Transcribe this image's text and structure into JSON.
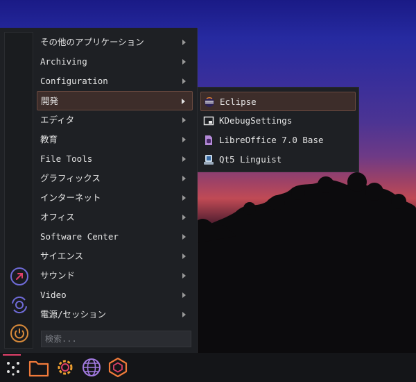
{
  "menu": {
    "items": [
      {
        "label": "その他のアプリケーション"
      },
      {
        "label": "Archiving"
      },
      {
        "label": "Configuration"
      },
      {
        "label": "開発"
      },
      {
        "label": "エディタ"
      },
      {
        "label": "教育"
      },
      {
        "label": "File Tools"
      },
      {
        "label": "グラフィックス"
      },
      {
        "label": "インターネット"
      },
      {
        "label": "オフィス"
      },
      {
        "label": "Software Center"
      },
      {
        "label": "サイエンス"
      },
      {
        "label": "サウンド"
      },
      {
        "label": "Video"
      },
      {
        "label": "電源/セッション"
      }
    ],
    "active_index": 3,
    "search_placeholder": "検索..."
  },
  "submenu": {
    "items": [
      {
        "label": "Eclipse",
        "icon": "eclipse-icon"
      },
      {
        "label": "KDebugSettings",
        "icon": "kdebugsettings-icon"
      },
      {
        "label": "LibreOffice 7.0 Base",
        "icon": "libreoffice-base-icon"
      },
      {
        "label": "Qt5 Linguist",
        "icon": "qt-linguist-icon"
      }
    ],
    "active_index": 0
  },
  "sidebar": {
    "buttons": [
      "logout-icon",
      "restart-icon",
      "power-icon"
    ]
  },
  "taskbar": {
    "icons": [
      "app-launcher-icon",
      "file-manager-icon",
      "settings-icon",
      "web-browser-icon",
      "package-icon"
    ]
  },
  "colors": {
    "accent": "#e0406a",
    "menu_bg": "#1e2024",
    "active_bg": "#3d2d2a"
  }
}
